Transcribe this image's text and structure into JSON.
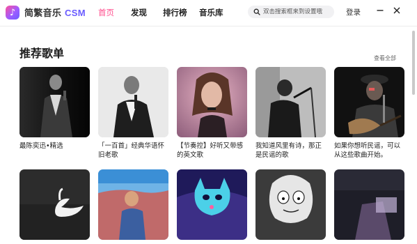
{
  "app": {
    "title_cn": "简繁音乐",
    "title_suffix": "CSM",
    "logo_glyph": "♪",
    "brand_color": "#ff4f8e",
    "accent_color": "#6a5cff"
  },
  "nav": {
    "tabs": [
      {
        "label": "首页",
        "active": true
      },
      {
        "label": "发现",
        "active": false
      },
      {
        "label": "排行榜",
        "active": false
      },
      {
        "label": "音乐库",
        "active": false
      }
    ]
  },
  "search": {
    "placeholder": "双击搜索框来到设置哦",
    "icon": "search-icon"
  },
  "header": {
    "login_label": "登录",
    "minimize_icon": "minimize-icon",
    "close_icon": "close-icon"
  },
  "section": {
    "title": "推荐歌单",
    "view_all_label": "查看全部"
  },
  "playlists_row1": [
    {
      "title": "最陈奕迅•精选"
    },
    {
      "title": "「一百首」经典华语怀旧老歌"
    },
    {
      "title": "【节奏控】好听又带感的英文歌"
    },
    {
      "title": "我知道风里有诗，那正是民谣的歌"
    },
    {
      "title": "如果你想听民谣，可以从这些歌曲开始。"
    }
  ],
  "playlists_row2": [
    {
      "title": ""
    },
    {
      "title": ""
    },
    {
      "title": ""
    },
    {
      "title": ""
    },
    {
      "title": ""
    }
  ]
}
